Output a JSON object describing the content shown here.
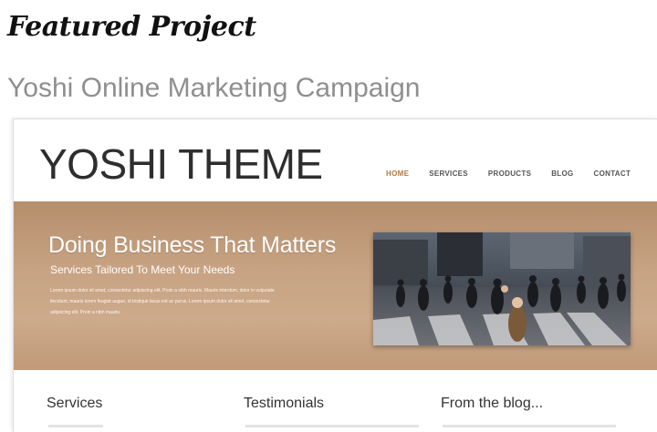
{
  "featured_heading": "Featured Project",
  "project_title": "Yoshi Online Marketing Campaign",
  "theme": {
    "logo": "YOSHI THEME",
    "nav": [
      "HOME",
      "SERVICES",
      "PRODUCTS",
      "BLOG",
      "CONTACT"
    ],
    "hero_title": "Doing Business That Matters",
    "hero_subtitle": "Services Tailored To Meet Your Needs",
    "hero_body": "Lorem ipsum dolor sit amet, consectetur adipiscing elit. Proin a nibh mauris. Mauris interdum, dolor in vulputate tincidunt, mauris lorem feugiat augue, id tristique lacus est ac purus. Lorem ipsum dolor sit amet, consectetur adipiscing elit. Proin a nibh mauris.",
    "sections": [
      "Services",
      "Testimonials",
      "From the blog..."
    ]
  },
  "colors": {
    "nav_active": "#b07a45",
    "hero_bg": "#c7a383"
  }
}
